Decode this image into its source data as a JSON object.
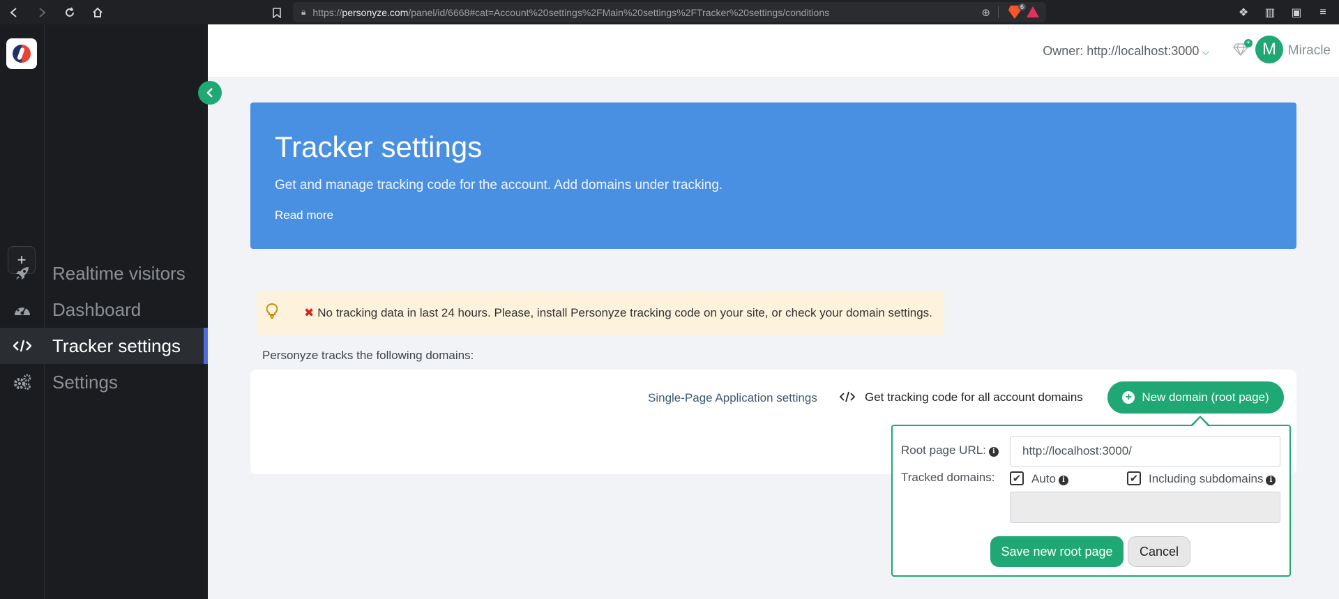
{
  "browser": {
    "url_scheme": "https://",
    "url_host": "personyze.com",
    "url_path": "/panel/id/6668#cat=Account%20settings%2FMain%20settings%2FTracker%20settings/conditions",
    "brave_badge": "6"
  },
  "sidebar": {
    "add_label": "+",
    "items": [
      {
        "label": "Realtime visitors",
        "icon": "rocket-icon"
      },
      {
        "label": "Dashboard",
        "icon": "dashboard-icon"
      },
      {
        "label": "Tracker settings",
        "icon": "code-icon",
        "active": true
      },
      {
        "label": "Settings",
        "icon": "gears-icon"
      }
    ]
  },
  "header": {
    "owner_label": "Owner: http://localhost:3000",
    "avatar_initial": "M",
    "username": "Miracle"
  },
  "banner": {
    "title": "Tracker settings",
    "description": "Get and manage tracking code for the account. Add domains under tracking.",
    "read_more": "Read more"
  },
  "alert": {
    "message": "No tracking data in last 24 hours. Please, install Personyze tracking code on your site, or check your domain settings."
  },
  "domains": {
    "intro": "Personyze tracks the following domains:",
    "spa_link": "Single-Page Application settings",
    "get_code": "Get tracking code for all account domains",
    "new_domain_button": "New domain (root page)"
  },
  "popover": {
    "root_url_label": "Root page URL:",
    "root_url_value": "http://localhost:3000/",
    "tracked_domains_label": "Tracked domains:",
    "auto_label": "Auto",
    "subdomains_label": "Including subdomains",
    "save_button": "Save new root page",
    "cancel_button": "Cancel"
  },
  "colors": {
    "accent": "#1fa774",
    "banner": "#4a90e2",
    "sidebar": "#1a1c1f",
    "alert_bg": "#fdf3dc"
  }
}
